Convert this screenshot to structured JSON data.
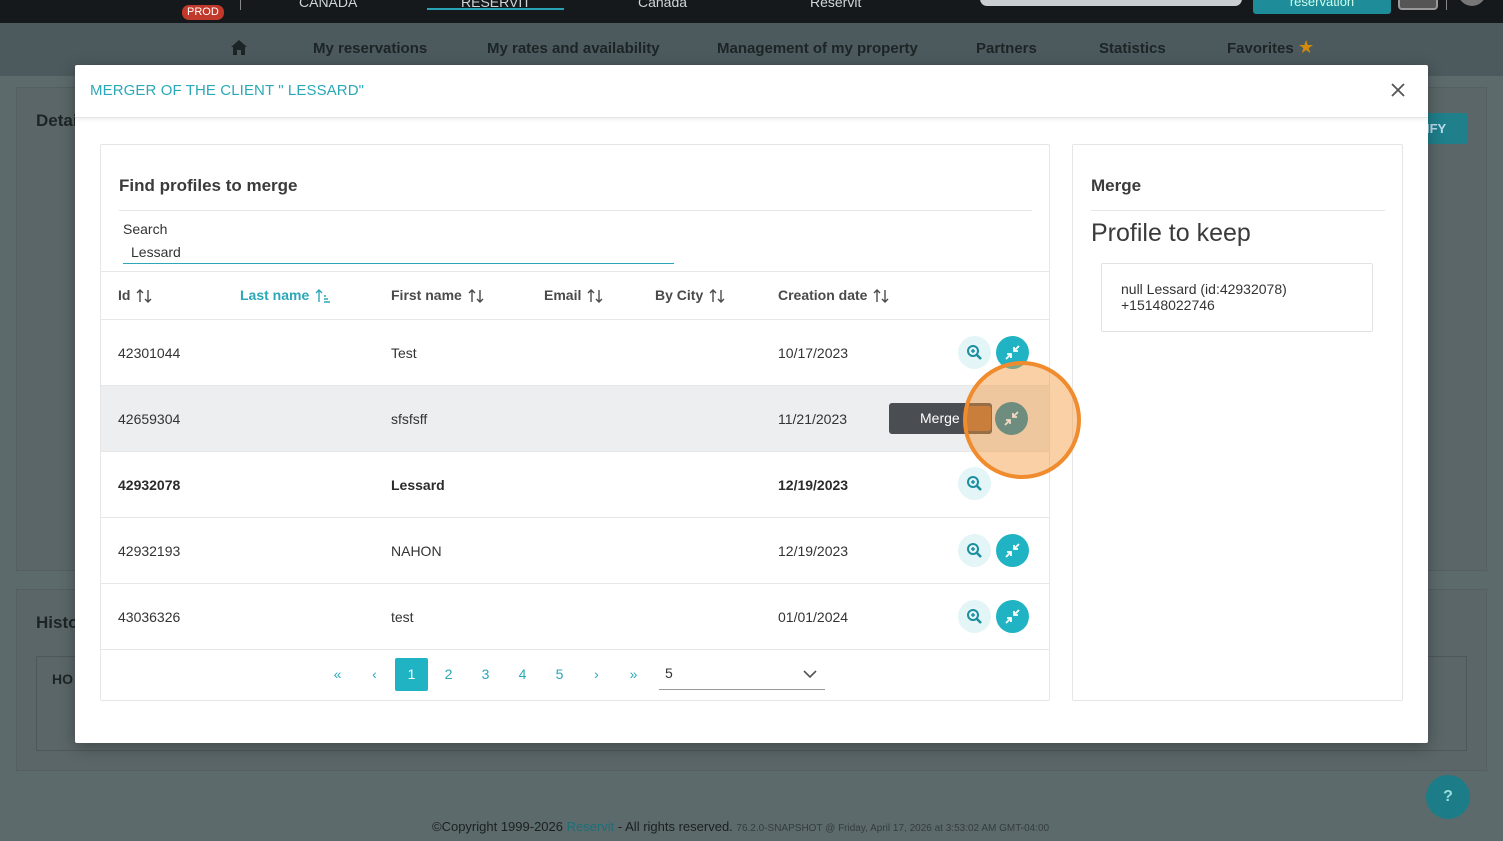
{
  "topbar": {
    "prod_badge": "PROD",
    "tabs": [
      "CANADA",
      "RESERVIT",
      "Canada",
      "Reservit"
    ],
    "reservation_button": "reservation"
  },
  "nav": {
    "items": [
      "My reservations",
      "My rates and availability",
      "Management of my property",
      "Partners",
      "Statistics",
      "Favorites"
    ]
  },
  "background": {
    "details_label": "Detai",
    "modify_label": "IFY",
    "history_label": "Histo",
    "history_col": "HO"
  },
  "modal": {
    "title": "MERGER OF THE CLIENT \" LESSARD\"",
    "find_panel": {
      "title": "Find profiles to merge",
      "search_label": "Search",
      "search_value": "Lessard",
      "columns": [
        "Id",
        "Last name",
        "First name",
        "Email",
        "By City",
        "Creation date"
      ],
      "sorted_column": "Last name",
      "rows": [
        {
          "id": "42301044",
          "last_name": "",
          "first_name": "Test",
          "email": "",
          "city": "",
          "created": "10/17/2023"
        },
        {
          "id": "42659304",
          "last_name": "",
          "first_name": "sfsfsff",
          "email": "",
          "city": "",
          "created": "11/21/2023"
        },
        {
          "id": "42932078",
          "last_name": "",
          "first_name": "Lessard",
          "email": "",
          "city": "",
          "created": "12/19/2023"
        },
        {
          "id": "42932193",
          "last_name": "",
          "first_name": "NAHON",
          "email": "",
          "city": "",
          "created": "12/19/2023"
        },
        {
          "id": "43036326",
          "last_name": "",
          "first_name": "test",
          "email": "",
          "city": "",
          "created": "01/01/2024"
        }
      ],
      "tooltip": "Merge",
      "pager": {
        "first": "«",
        "prev": "‹",
        "pages": [
          "1",
          "2",
          "3",
          "4",
          "5"
        ],
        "current_page": "1",
        "next": "›",
        "last": "»",
        "page_size": "5"
      }
    },
    "merge_panel": {
      "title": "Merge",
      "subtitle": "Profile to keep",
      "profile_line1": "null Lessard (id:42932078)",
      "profile_line2": "+15148022746"
    }
  },
  "help": "?",
  "footer": {
    "copyright": "©Copyright 1999-2026 ",
    "brand": "Reservit",
    "rights": " - All rights reserved. ",
    "version": "76.2.0-SNAPSHOT @ Friday, April 17, 2026 at 3:53:02 AM GMT-04:00"
  },
  "colors": {
    "accent": "#2aa8b8",
    "merge_button": "#1fb3c4",
    "click_highlight": "#f08c2e"
  },
  "icons": {
    "view": "magnifier-plus-icon",
    "merge": "arrows-merge-icon",
    "sort": "sort-arrows-icon",
    "close": "close-icon",
    "home": "home-icon",
    "favorite": "star-icon"
  }
}
